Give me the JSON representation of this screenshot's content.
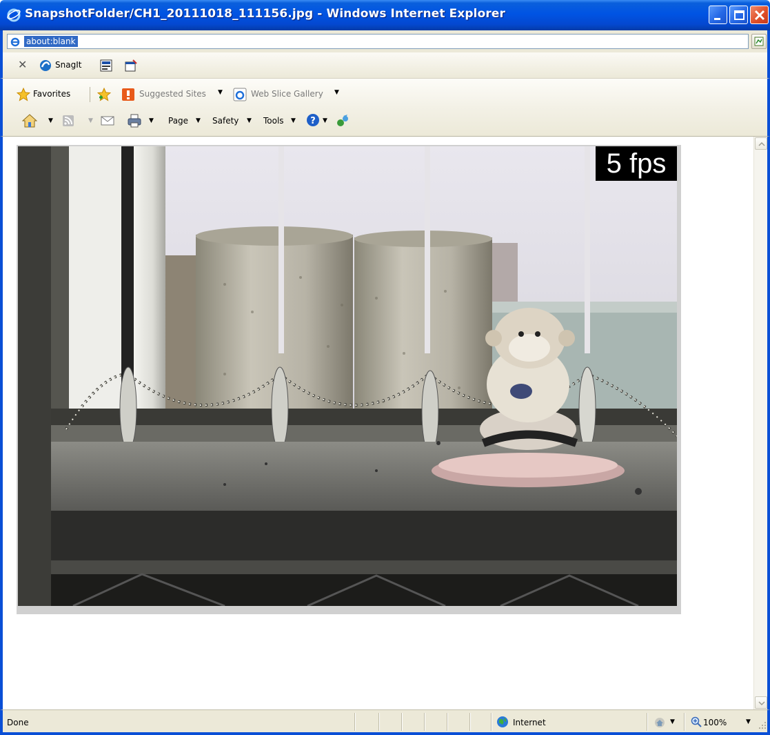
{
  "window": {
    "title": "SnapshotFolder/CH1_20111018_111156.jpg - Windows Internet Explorer",
    "icon": "ie-icon"
  },
  "address": {
    "url": "about:blank"
  },
  "snagit": {
    "label": "SnagIt"
  },
  "favorites_bar": {
    "favorites_label": "Favorites",
    "suggested_sites_label": "Suggested Sites",
    "web_slice_label": "Web Slice Gallery"
  },
  "command_bar": {
    "page_label": "Page",
    "safety_label": "Safety",
    "tools_label": "Tools"
  },
  "content": {
    "overlay_text": "5 fps"
  },
  "status": {
    "text": "Done",
    "zone": "Internet",
    "zoom": "100%"
  },
  "colors": {
    "titlebar": "#0054e3",
    "chrome": "#ece9d8",
    "close_button": "#e0512a",
    "selection": "#316ac5"
  }
}
